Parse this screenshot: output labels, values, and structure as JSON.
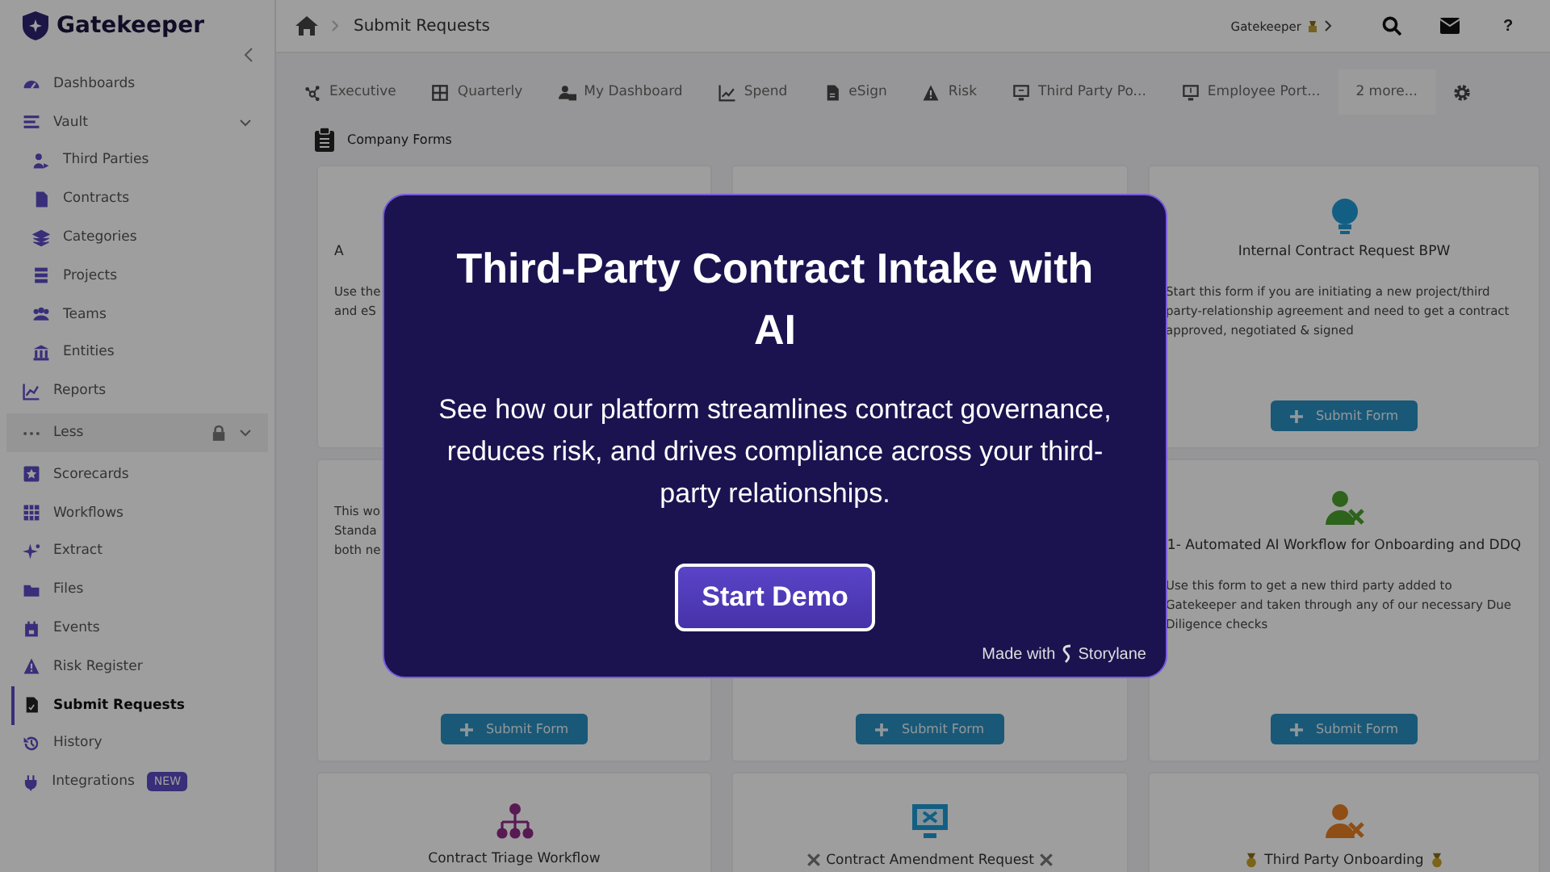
{
  "brand": {
    "name": "Gatekeeper"
  },
  "sidebar": {
    "items": [
      {
        "label": "Dashboards",
        "selected": false
      },
      {
        "label": "Vault",
        "selected": false,
        "expanded": true,
        "children": [
          {
            "label": "Third Parties",
            "selected": false
          },
          {
            "label": "Contracts",
            "selected": false
          },
          {
            "label": "Categories",
            "selected": false
          },
          {
            "label": "Projects",
            "selected": false
          },
          {
            "label": "Teams",
            "selected": false
          },
          {
            "label": "Entities",
            "selected": false
          }
        ]
      },
      {
        "label": "Reports",
        "selected": false
      },
      {
        "label": "Less",
        "selected": false,
        "expanded": true,
        "locked": true
      },
      {
        "label": "Scorecards",
        "selected": false
      },
      {
        "label": "Workflows",
        "selected": false
      },
      {
        "label": "Extract",
        "selected": false
      },
      {
        "label": "Files",
        "selected": false
      },
      {
        "label": "Events",
        "selected": false
      },
      {
        "label": "Risk Register",
        "selected": false
      },
      {
        "label": "Submit Requests",
        "selected": true
      },
      {
        "label": "History",
        "selected": false
      },
      {
        "label": "Integrations",
        "selected": false,
        "badge": "NEW"
      }
    ]
  },
  "breadcrumb": {
    "page": "Submit Requests"
  },
  "account": {
    "name": "Gatekeeper"
  },
  "help": "?",
  "tabs": [
    {
      "label": "Executive",
      "kind": "tab"
    },
    {
      "label": "Quarterly",
      "kind": "tab"
    },
    {
      "label": "My Dashboard",
      "kind": "tab"
    },
    {
      "label": "Spend",
      "kind": "tab"
    },
    {
      "label": "eSign",
      "kind": "tab"
    },
    {
      "label": "Risk",
      "kind": "tab"
    },
    {
      "label": "Third Party Po...",
      "kind": "tab"
    },
    {
      "label": "Employee Port...",
      "kind": "tab"
    },
    {
      "label": "2 more...",
      "kind": "more"
    }
  ],
  "section": {
    "title": "Company Forms"
  },
  "forms": [
    {
      "kind": "fragment",
      "title": "A",
      "description": "Use the\nand eS"
    },
    {
      "kind": "covered"
    },
    {
      "kind": "form",
      "title": "Internal Contract Request BPW",
      "description": "Start this form if you are initiating a new project/third party-relationship agreement and need to get a contract approved, negotiated & signed",
      "button": "Submit Form"
    },
    {
      "kind": "fragment",
      "description": "This wo\nStanda\nboth ne",
      "button": "Submit Form"
    },
    {
      "kind": "fragment",
      "button": "Submit Form"
    },
    {
      "kind": "form",
      "title": "1- Automated AI Workflow for Onboarding and DDQ",
      "description": "Use this form to get a new third party added to Gatekeeper and taken through any of our necessary Due Diligence checks",
      "button": "Submit Form"
    },
    {
      "kind": "form",
      "title": "Contract Triage Workflow"
    },
    {
      "kind": "form",
      "title": "Contract Amendment Request"
    },
    {
      "kind": "form",
      "title": "Third Party Onboarding"
    }
  ],
  "modal": {
    "title": "Third-Party Contract Intake with AI",
    "body": "See how our platform streamlines contract governance, reduces risk, and drives compliance across your third-party relationships.",
    "button": "Start Demo",
    "credit": "Made with",
    "credit_brand": "Storylane"
  }
}
